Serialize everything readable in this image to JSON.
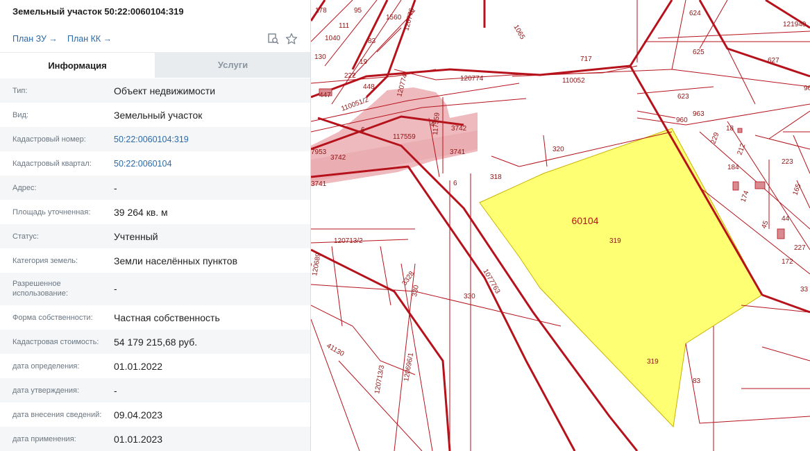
{
  "panel": {
    "title": "Земельный участок 50:22:0060104:319",
    "links": {
      "plan_zu": "План ЗУ →",
      "plan_kk": "План КК →"
    },
    "tabs": {
      "info": "Информация",
      "services": "Услуги"
    },
    "rows": [
      {
        "label": "Тип:",
        "value": "Объект недвижимости",
        "link": false
      },
      {
        "label": "Вид:",
        "value": "Земельный участок",
        "link": false
      },
      {
        "label": "Кадастровый номер:",
        "value": "50:22:0060104:319",
        "link": true
      },
      {
        "label": "Кадастровый квартал:",
        "value": "50:22:0060104",
        "link": true
      },
      {
        "label": "Адрес:",
        "value": "-",
        "link": false
      },
      {
        "label": "Площадь уточненная:",
        "value": "39 264 кв. м",
        "link": false
      },
      {
        "label": "Статус:",
        "value": "Учтенный",
        "link": false
      },
      {
        "label": "Категория земель:",
        "value": "Земли населённых пунктов",
        "link": false
      },
      {
        "label": "Разрешенное использование:",
        "value": "-",
        "link": false
      },
      {
        "label": "Форма собственности:",
        "value": "Частная собственность",
        "link": false
      },
      {
        "label": "Кадастровая стоимость:",
        "value": "54 179 215,68 руб.",
        "link": false
      },
      {
        "label": "дата определения:",
        "value": "01.01.2022",
        "link": false
      },
      {
        "label": "дата утверждения:",
        "value": "-",
        "link": false
      },
      {
        "label": "дата внесения сведений:",
        "value": "09.04.2023",
        "link": false
      },
      {
        "label": "дата применения:",
        "value": "01.01.2023",
        "link": false
      }
    ]
  },
  "icons": {
    "print": "print-preview-icon",
    "favorite": "star-icon"
  },
  "map": {
    "colors": {
      "boundary": "#b5121b",
      "selected_fill": "#ffff73",
      "zone_fill": "#e8a3a8"
    },
    "quarter_label": "60104",
    "selected_labels": [
      "319",
      "319"
    ],
    "parcel_labels": [
      "178",
      "95",
      "1560",
      "111",
      "1040",
      "83",
      "19",
      "130",
      "222",
      "120776",
      "447",
      "448",
      "1065",
      "717",
      "624",
      "625",
      "627",
      "121940",
      "120774",
      "110052",
      "623",
      "96",
      "120774",
      "110051/2",
      "4",
      "117559",
      "3742",
      "960",
      "963",
      "6",
      "117559",
      "3741",
      "7953",
      "3742",
      "3741",
      "320",
      "18",
      "229",
      "212",
      "223",
      "184",
      "318",
      "6",
      "174",
      "165",
      "45",
      "44",
      "227",
      "120713/2",
      "172",
      "120689",
      "120713/1",
      "3328",
      "330",
      "330",
      "33",
      "41130",
      "120713/3",
      "120696/1",
      "83",
      "1077763"
    ]
  }
}
